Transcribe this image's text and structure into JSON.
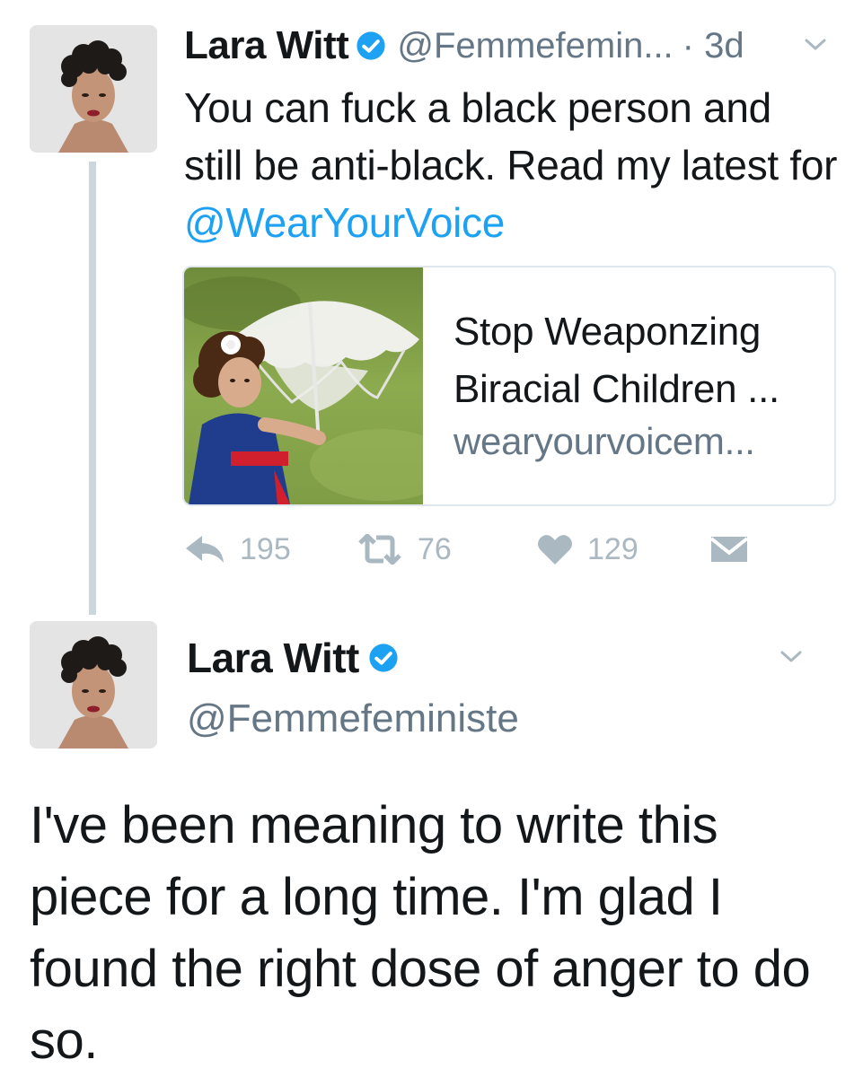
{
  "colors": {
    "text": "#14171a",
    "secondary": "#657786",
    "link": "#1da1f2",
    "verified": "#1da1f2",
    "thread_line": "#ccd6dd",
    "action_gray": "#aab8c2"
  },
  "tweet_parent": {
    "author_name": "Lara Witt",
    "verified_icon": "verified-badge-icon",
    "handle": "@Femmefemin...",
    "time": "· 3d",
    "text_before_mention": "You can fuck a black person and still be anti-black. Read my latest for ",
    "mention": "@WearYourVoice",
    "card": {
      "title_line1": "Stop Weaponzing",
      "title_line2": "Biracial Children ...",
      "domain": "wearyourvoicem..."
    },
    "actions": {
      "reply_count": "195",
      "retweet_count": "76",
      "like_count": "129"
    }
  },
  "tweet_main": {
    "author_name": "Lara Witt",
    "handle": "@Femmefeministe",
    "text": "I've been meaning to write this piece for a long time. I'm glad I found the right dose of anger to do so."
  }
}
